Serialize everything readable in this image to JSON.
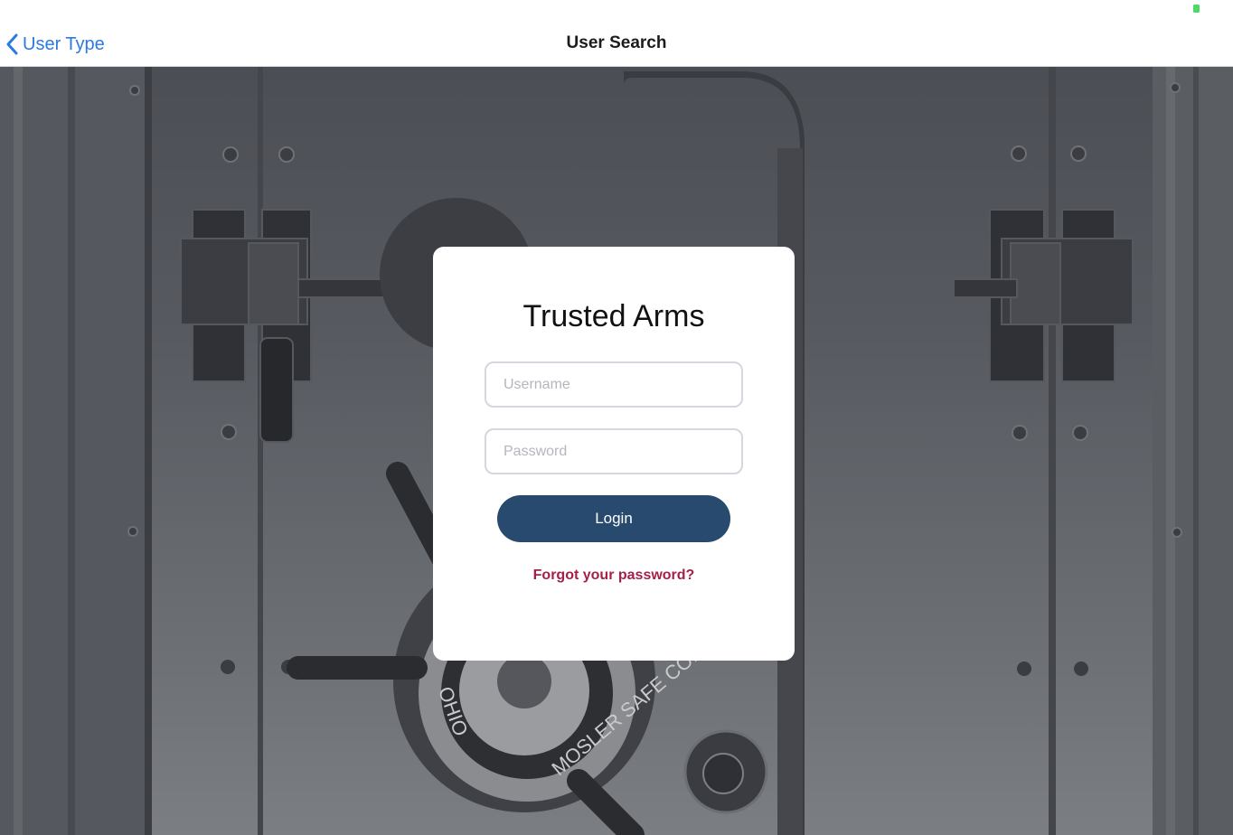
{
  "nav": {
    "back_label": "User Type",
    "title": "User Search"
  },
  "login_card": {
    "title": "Trusted Arms",
    "username_placeholder": "Username",
    "password_placeholder": "Password",
    "login_label": "Login",
    "forgot_label": "Forgot your password?"
  },
  "background": {
    "dial_text_left": "OHIO",
    "dial_text_right": "MOSLER SAFE CO."
  },
  "colors": {
    "accent_blue": "#2a7ae2",
    "button_navy": "#284a6e",
    "link_crimson": "#a61f48",
    "battery_green": "#4cd964"
  },
  "icons": [
    "chevron-left-icon",
    "battery-icon"
  ]
}
